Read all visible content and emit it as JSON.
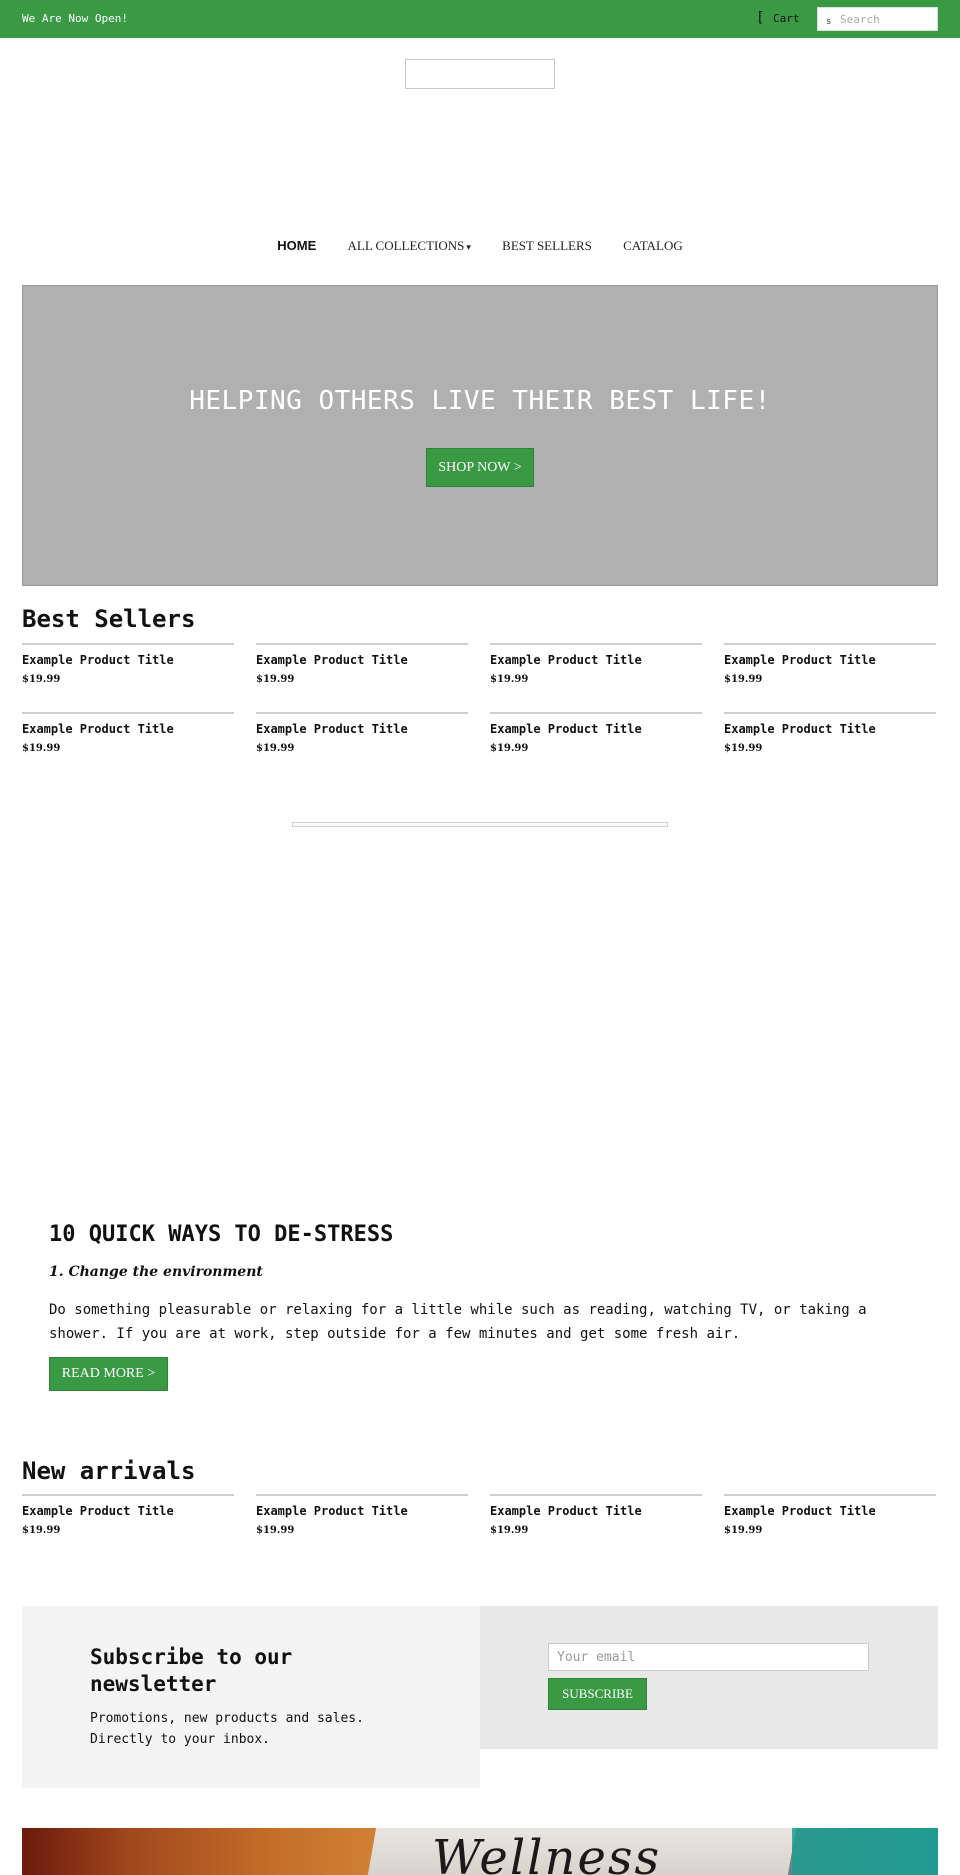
{
  "topbar": {
    "announcement": "We Are Now Open!",
    "cart_icon": "[",
    "cart_label": "Cart",
    "search_icon": "s",
    "search_placeholder": "Search"
  },
  "nav": {
    "items": [
      {
        "label": "HOME"
      },
      {
        "label": "ALL COLLECTIONS",
        "chevron": "▾"
      },
      {
        "label": "BEST SELLERS"
      },
      {
        "label": "CATALOG"
      }
    ]
  },
  "hero": {
    "title": "HELPING OTHERS LIVE THEIR BEST LIFE!",
    "button": "SHOP NOW >"
  },
  "best_sellers": {
    "title": "Best Sellers",
    "products": [
      {
        "title": "Example Product Title",
        "price": "$19.99"
      },
      {
        "title": "Example Product Title",
        "price": "$19.99"
      },
      {
        "title": "Example Product Title",
        "price": "$19.99"
      },
      {
        "title": "Example Product Title",
        "price": "$19.99"
      },
      {
        "title": "Example Product Title",
        "price": "$19.99"
      },
      {
        "title": "Example Product Title",
        "price": "$19.99"
      },
      {
        "title": "Example Product Title",
        "price": "$19.99"
      },
      {
        "title": "Example Product Title",
        "price": "$19.99"
      }
    ]
  },
  "blog": {
    "title": "10 QUICK WAYS TO DE-STRESS",
    "subtitle": "1. Change the environment",
    "body": "Do something pleasurable or relaxing for a little while such as reading, watching TV, or taking a shower. If you are at work, step outside for a few minutes and get some fresh air.",
    "button": "READ MORE >"
  },
  "new_arrivals": {
    "title": "New arrivals",
    "products": [
      {
        "title": "Example Product Title",
        "price": "$19.99"
      },
      {
        "title": "Example Product Title",
        "price": "$19.99"
      },
      {
        "title": "Example Product Title",
        "price": "$19.99"
      },
      {
        "title": "Example Product Title",
        "price": "$19.99"
      }
    ]
  },
  "newsletter": {
    "title": "Subscribe to our newsletter",
    "text": "Promotions, new products and sales. Directly to your inbox.",
    "email_placeholder": "Your email",
    "button": "SUBSCRIBE"
  },
  "banner": {
    "text": "Wellness"
  },
  "colors": {
    "accent": "#3a9a44",
    "hero_bg": "#b0b0b0",
    "newsletter_left": "#f4f4f4",
    "newsletter_right": "#e8e8e8"
  }
}
